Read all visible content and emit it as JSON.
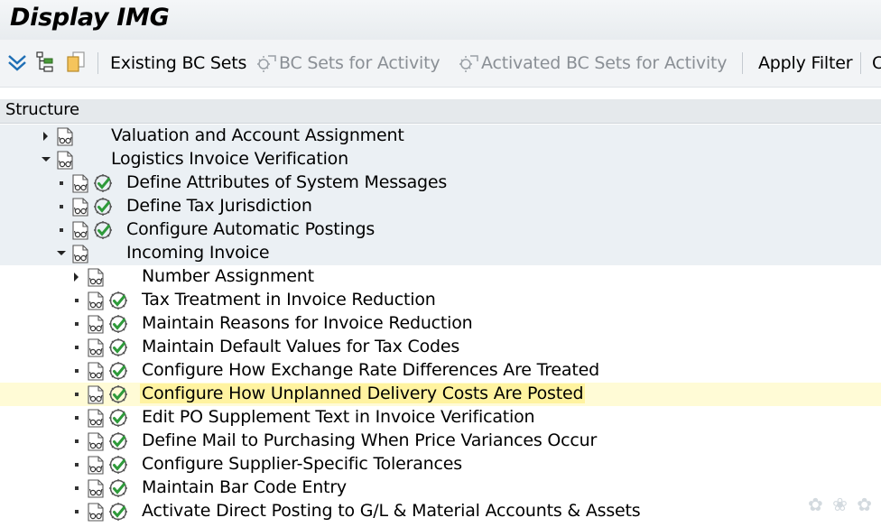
{
  "window": {
    "title": "Display IMG"
  },
  "toolbar": {
    "existing_bc_sets": "Existing BC Sets",
    "bc_sets_for_activity": "BC Sets for Activity",
    "activated_bc_sets": "Activated BC Sets for Activity",
    "apply_filter": "Apply Filter",
    "overflow": "C"
  },
  "structure": {
    "header": "Structure",
    "rows": [
      {
        "label": "Valuation and Account Assignment",
        "expander": "collapsed",
        "activity": false
      },
      {
        "label": "Logistics Invoice Verification",
        "expander": "expanded",
        "activity": false
      },
      {
        "label": "Define Attributes of System Messages",
        "expander": "leaf",
        "activity": true
      },
      {
        "label": "Define Tax Jurisdiction",
        "expander": "leaf",
        "activity": true
      },
      {
        "label": "Configure Automatic Postings",
        "expander": "leaf",
        "activity": true
      },
      {
        "label": "Incoming Invoice",
        "expander": "expanded",
        "activity": false
      },
      {
        "label": "Number Assignment",
        "expander": "collapsed",
        "activity": false
      },
      {
        "label": "Tax Treatment in Invoice Reduction",
        "expander": "leaf",
        "activity": true
      },
      {
        "label": "Maintain Reasons for Invoice Reduction",
        "expander": "leaf",
        "activity": true
      },
      {
        "label": "Maintain Default Values for Tax Codes",
        "expander": "leaf",
        "activity": true
      },
      {
        "label": "Configure How Exchange Rate Differences Are Treated",
        "expander": "leaf",
        "activity": true
      },
      {
        "label": "Configure How Unplanned Delivery Costs Are Posted",
        "expander": "leaf",
        "activity": true,
        "selected": true
      },
      {
        "label": "Edit PO Supplement Text in Invoice Verification",
        "expander": "leaf",
        "activity": true
      },
      {
        "label": "Define Mail to Purchasing When Price Variances Occur",
        "expander": "leaf",
        "activity": true
      },
      {
        "label": "Configure Supplier-Specific Tolerances",
        "expander": "leaf",
        "activity": true
      },
      {
        "label": "Maintain Bar Code Entry",
        "expander": "leaf",
        "activity": true
      },
      {
        "label": "Activate Direct Posting to G/L & Material Accounts & Assets",
        "expander": "leaf",
        "activity": true
      }
    ]
  },
  "colors": {
    "row_band": "#ebf0f4",
    "row_selected": "#fff9c4",
    "activity_green": "#2e9a3a"
  },
  "icons": {
    "doc": "document-glasses-icon",
    "activity": "execute-activity-icon",
    "filter": "expand-filter-icon",
    "bcset": "bc-set-icon"
  }
}
